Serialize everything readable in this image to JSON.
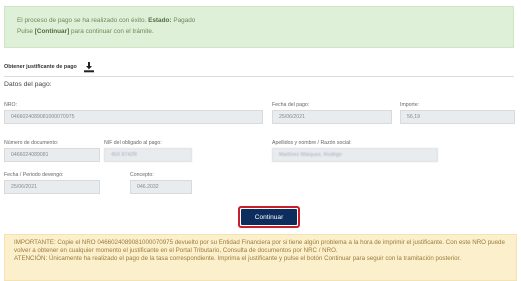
{
  "success_alert": {
    "line1_text": "El proceso de pago se ha realizado con éxito.",
    "estado_label": "Estado:",
    "estado_value": "Pagado",
    "line2_prefix": "Pulse",
    "line2_link": "[Continuar]",
    "line2_suffix": "para continuar con el trámite."
  },
  "justificante": {
    "label": "Obtener justificante de pago",
    "icon": "download-icon"
  },
  "section": {
    "title": "Datos del pago:"
  },
  "fields": {
    "nro_label": "NRO:",
    "nro_value": "0466024089081000070975",
    "fecha_pago_label": "Fecha del pago:",
    "fecha_pago_value": "25/06/2021",
    "importe_label": "Importe:",
    "importe_value": "56,19",
    "num_documento_label": "Número de documento:",
    "num_documento_value": "0466024089081",
    "nif_label": "NIF del obligado al pago:",
    "nif_value": "45X 8742R",
    "apellidos_label": "Apellidos y nombre / Razón social:",
    "apellidos_value": "Martínez Márquez, Rodrigo",
    "devengo_label": "Fecha / Periodo devengo:",
    "devengo_value": "25/06/2021",
    "concepto_label": "Concepto:",
    "concepto_value": "046.2032"
  },
  "button": {
    "continuar_label": "Continuar"
  },
  "warning": {
    "line1": "IMPORTANTE: Copie el NRO 0466024089081000070975 devuelto por su Entidad Financiera por si tiene algún problema a la hora de imprimir el justificante. Con este NRO puede volver a obtener en cualquier momento el justificante en el Portal Tributario, Consulta de documentos por NRC / NRO.",
    "line2": "ATENCIÓN: Únicamente ha realizado el pago de la tasa correspondiente. Imprima el justificante y pulse el botón Continuar para seguir con la tramitación posterior."
  },
  "colors": {
    "success_bg": "#dff0d8",
    "warning_bg": "#fcf0cc",
    "button_bg": "#0d2d5c",
    "button_border": "#c91f2a"
  }
}
